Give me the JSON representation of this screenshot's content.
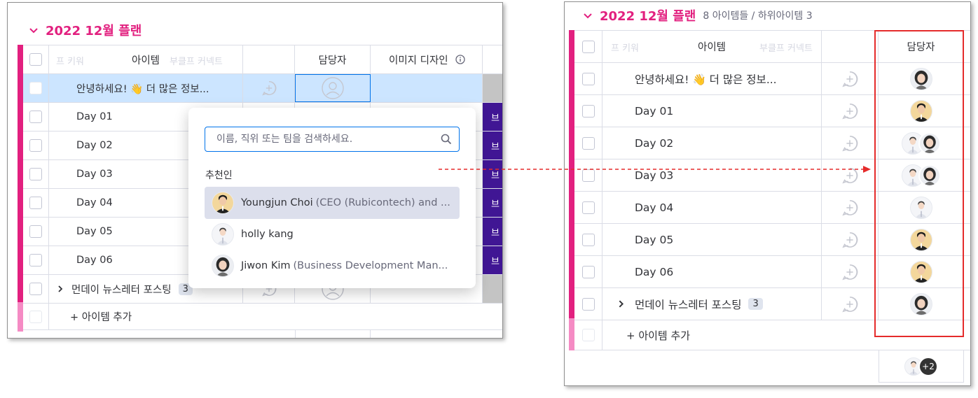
{
  "group_title": "2022 12월 플랜",
  "group_meta": "8 아이템들 / 하위아이템 3",
  "col_item": "아이템",
  "col_owner": "담당자",
  "col_design": "이미지 디자인",
  "ghost_cols": [
    "프 키워",
    "부클프 커넥트"
  ],
  "rows": [
    {
      "name": "안녕하세요! 👋 더 많은 정보...",
      "owners": [
        "f1"
      ]
    },
    {
      "name": "Day 01",
      "owners": [
        "m1"
      ]
    },
    {
      "name": "Day 02",
      "owners": [
        "m2",
        "f1"
      ]
    },
    {
      "name": "Day 03",
      "owners": [
        "m2",
        "f1"
      ]
    },
    {
      "name": "Day 04",
      "owners": [
        "m2"
      ]
    },
    {
      "name": "Day 05",
      "owners": [
        "m1"
      ]
    },
    {
      "name": "Day 06",
      "owners": [
        "m1"
      ]
    },
    {
      "name": "먼데이 뉴스레터 포스팅",
      "owners": [
        "f1"
      ],
      "subitems": "3"
    }
  ],
  "add_item": "+ 아이템 추가",
  "purple_label": "브",
  "summary_more": "+2",
  "popup": {
    "search_placeholder": "이름, 직위 또는 팀을 검색하세요.",
    "suggested": "추천인",
    "people": [
      {
        "name": "Youngjun Choi",
        "role": "(CEO (Rubicontech) and ..."
      },
      {
        "name": "holly kang",
        "role": ""
      },
      {
        "name": "Jiwon Kim",
        "role": "(Business Development Man..."
      }
    ]
  },
  "colors": {
    "group": "#e2207f",
    "group_light": "#f58bc4",
    "purple": "#401694",
    "selected_row": "#cce5ff",
    "focus": "#0073ea",
    "annotation": "#e52b2b"
  },
  "icons": [
    "chevron-down-icon",
    "info-icon",
    "add-update-icon",
    "person-placeholder-icon",
    "search-icon",
    "chevron-right-icon"
  ]
}
